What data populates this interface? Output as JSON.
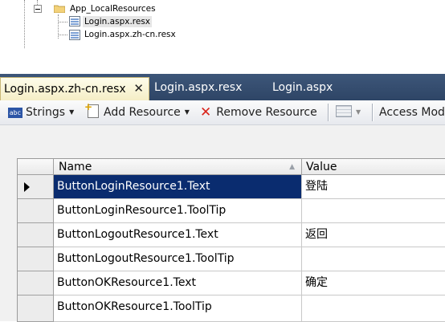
{
  "tree": {
    "folder_label": "App_LocalResources",
    "files": [
      {
        "label": "Login.aspx.resx",
        "selected": true
      },
      {
        "label": "Login.aspx.zh-cn.resx",
        "selected": false
      }
    ]
  },
  "tabs": [
    {
      "label": "Login.aspx.zh-cn.resx",
      "active": true,
      "close_glyph": "✕"
    },
    {
      "label": "Login.aspx.resx",
      "active": false
    },
    {
      "label": "Login.aspx",
      "active": false
    }
  ],
  "toolbar": {
    "strings_icon_text": "abc",
    "strings_label": "Strings",
    "add_resource_label": "Add Resource",
    "remove_resource_label": "Remove Resource",
    "access_modifier_label": "Access Modi"
  },
  "grid": {
    "columns": {
      "name": "Name",
      "value": "Value"
    },
    "sort_glyph": "▲",
    "rows": [
      {
        "name": "ButtonLoginResource1.Text",
        "value": "登陆"
      },
      {
        "name": "ButtonLoginResource1.ToolTip",
        "value": ""
      },
      {
        "name": "ButtonLogoutResource1.Text",
        "value": "返回"
      },
      {
        "name": "ButtonLogoutResource1.ToolTip",
        "value": ""
      },
      {
        "name": "ButtonOKResource1.Text",
        "value": "确定"
      },
      {
        "name": "ButtonOKResource1.ToolTip",
        "value": ""
      }
    ]
  }
}
